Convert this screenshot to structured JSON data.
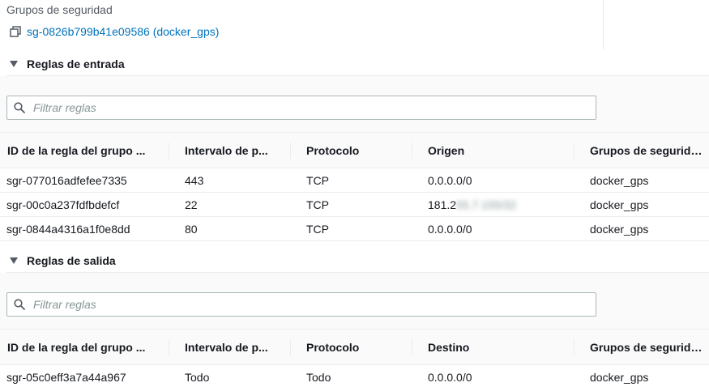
{
  "security_groups": {
    "label": "Grupos de seguridad",
    "link_text": "sg-0826b799b41e09586 (docker_gps)"
  },
  "icons": {
    "copy": "copy-icon",
    "search": "search-icon",
    "caret": "caret-down-icon"
  },
  "inbound": {
    "title": "Reglas de entrada",
    "filter_placeholder": "Filtrar reglas",
    "columns": [
      "ID de la regla del grupo ...",
      "Intervalo de p...",
      "Protocolo",
      "Origen",
      "Grupos de seguridad"
    ],
    "rows": [
      {
        "id": "sgr-077016adfefee7335",
        "ports": "443",
        "protocol": "TCP",
        "source": "0.0.0.0/0",
        "group": "docker_gps"
      },
      {
        "id": "sgr-00c0a237fdfbdefcf",
        "ports": "22",
        "protocol": "TCP",
        "source_visible": "181.2",
        "source_redacted": "55.7.155/32",
        "group": "docker_gps"
      },
      {
        "id": "sgr-0844a4316a1f0e8dd",
        "ports": "80",
        "protocol": "TCP",
        "source": "0.0.0.0/0",
        "group": "docker_gps"
      }
    ]
  },
  "outbound": {
    "title": "Reglas de salida",
    "filter_placeholder": "Filtrar reglas",
    "columns": [
      "ID de la regla del grupo ...",
      "Intervalo de p...",
      "Protocolo",
      "Destino",
      "Grupos de seguridad"
    ],
    "rows": [
      {
        "id": "sgr-05c0eff3a7a44a967",
        "ports": "Todo",
        "protocol": "Todo",
        "destination": "0.0.0.0/0",
        "group": "docker_gps"
      }
    ]
  },
  "colors": {
    "link": "#0073bb",
    "text": "#16191f",
    "muted": "#545b64",
    "border": "#eaeded"
  }
}
